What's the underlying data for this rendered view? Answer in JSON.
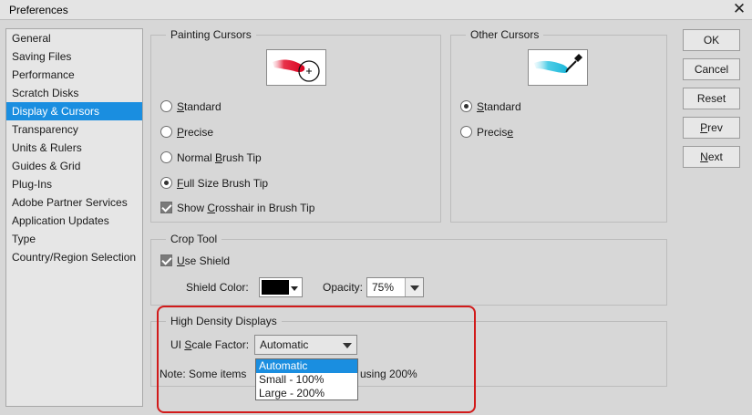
{
  "window": {
    "title": "Preferences",
    "close_glyph": "✕"
  },
  "sidebar": {
    "items": [
      {
        "label": "General",
        "selected": false
      },
      {
        "label": "Saving Files",
        "selected": false
      },
      {
        "label": "Performance",
        "selected": false
      },
      {
        "label": "Scratch Disks",
        "selected": false
      },
      {
        "label": "Display & Cursors",
        "selected": true
      },
      {
        "label": "Transparency",
        "selected": false
      },
      {
        "label": "Units & Rulers",
        "selected": false
      },
      {
        "label": "Guides & Grid",
        "selected": false
      },
      {
        "label": "Plug-Ins",
        "selected": false
      },
      {
        "label": "Adobe Partner Services",
        "selected": false
      },
      {
        "label": "Application Updates",
        "selected": false
      },
      {
        "label": "Type",
        "selected": false
      },
      {
        "label": "Country/Region Selection",
        "selected": false
      }
    ]
  },
  "painting_cursors": {
    "legend": "Painting Cursors",
    "options": [
      {
        "pre": "",
        "u": "S",
        "post": "tandard",
        "checked": false
      },
      {
        "pre": "",
        "u": "P",
        "post": "recise",
        "checked": false
      },
      {
        "pre": "Normal ",
        "u": "B",
        "post": "rush Tip",
        "checked": false
      },
      {
        "pre": "",
        "u": "F",
        "post": "ull Size Brush Tip",
        "checked": true
      }
    ],
    "crosshair": {
      "pre": "Show ",
      "u": "C",
      "post": "rosshair in Brush Tip",
      "checked": true
    }
  },
  "other_cursors": {
    "legend": "Other Cursors",
    "options": [
      {
        "pre": "",
        "u": "S",
        "post": "tandard",
        "checked": true
      },
      {
        "pre": "Precis",
        "u": "e",
        "post": "",
        "checked": false
      }
    ]
  },
  "crop_tool": {
    "legend": "Crop Tool",
    "use_shield": {
      "pre": "",
      "u": "U",
      "post": "se Shield",
      "checked": true
    },
    "shield_color_label": "Shield Color:",
    "shield_color": "#000000",
    "opacity_label": "Opacity:",
    "opacity_value": "75%"
  },
  "high_density": {
    "legend": "High Density Displays",
    "scale_label_pre": "UI ",
    "scale_label_u": "S",
    "scale_label_post": "cale Factor:",
    "scale_value": "Automatic",
    "note_left": "Note: Some items",
    "note_right": "using 200%",
    "dropdown_options": [
      {
        "label": "Automatic",
        "highlighted": true
      },
      {
        "label": "Small - 100%",
        "highlighted": false
      },
      {
        "label": "Large - 200%",
        "highlighted": false
      }
    ]
  },
  "buttons": {
    "ok": {
      "pre": "",
      "u": "",
      "post": "OK"
    },
    "cancel": {
      "pre": "",
      "u": "",
      "post": "Cancel"
    },
    "reset": {
      "pre": "",
      "u": "",
      "post": "Reset"
    },
    "prev": {
      "pre": "",
      "u": "P",
      "post": "rev"
    },
    "next": {
      "pre": "",
      "u": "N",
      "post": "ext"
    }
  },
  "colors": {
    "selection": "#1a8ee0",
    "highlight_ring": "#d11a1a"
  }
}
